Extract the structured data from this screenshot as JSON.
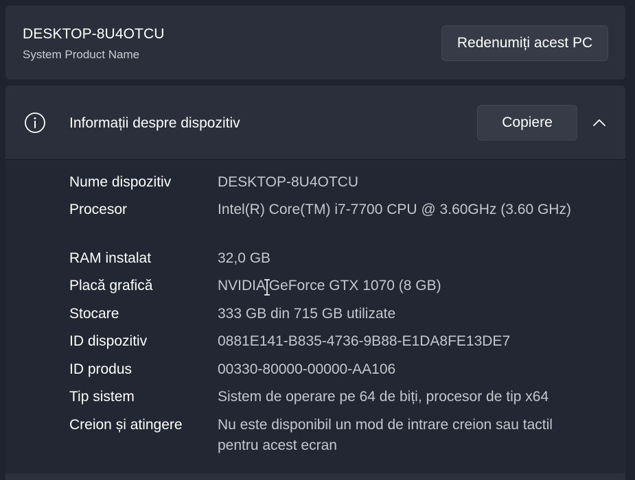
{
  "system": {
    "pc_name": "DESKTOP-8U4OTCU",
    "product_name": "System Product Name",
    "rename_label": "Redenumiți acest PC"
  },
  "device_info": {
    "title": "Informații despre dispozitiv",
    "copy_label": "Copiere",
    "expanded": true,
    "rows": [
      {
        "label": "Nume dispozitiv",
        "value": "DESKTOP-8U4OTCU"
      },
      {
        "label": "Procesor",
        "value": "Intel(R) Core(TM) i7-7700 CPU @ 3.60GHz (3.60 GHz)"
      },
      {
        "label": "RAM instalat",
        "value": "32,0 GB"
      },
      {
        "label": "Placă grafică",
        "value": "NVIDIA GeForce GTX 1070 (8 GB)"
      },
      {
        "label": "Stocare",
        "value": "333 GB din 715 GB utilizate"
      },
      {
        "label": "ID dispozitiv",
        "value": "0881E141-B835-4736-9B88-E1DA8FE13DE7"
      },
      {
        "label": "ID produs",
        "value": "00330-80000-00000-AA106"
      },
      {
        "label": "Tip sistem",
        "value": "Sistem de operare pe 64 de biți, procesor de tip x64"
      },
      {
        "label": "Creion și atingere",
        "value": "Nu este disponibil un mod de intrare creion sau tactil pentru acest ecran"
      }
    ]
  },
  "icons": {
    "info": "info-circle-icon",
    "collapse": "chevron-up-icon",
    "cursor": "text-cursor-icon"
  },
  "colors": {
    "background": "#1f2330",
    "card": "#2b2f3b",
    "button": "#373b47",
    "text_primary": "#ffffff",
    "text_secondary": "#c4c7ce"
  }
}
